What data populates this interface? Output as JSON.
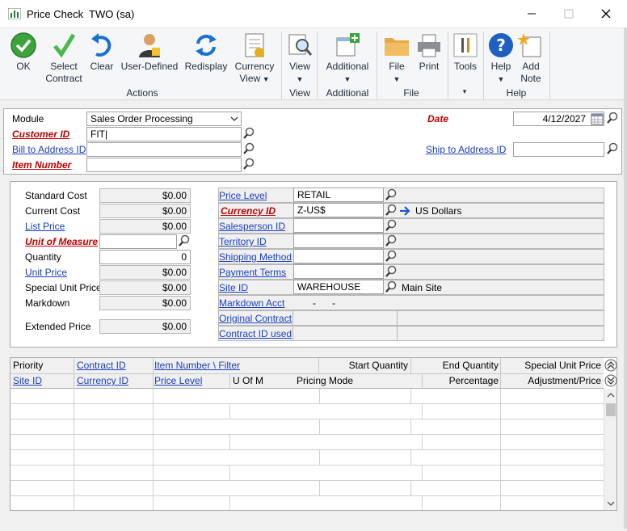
{
  "window": {
    "title": "Price Check",
    "company": "TWO (sa)"
  },
  "ribbon": {
    "buttons": {
      "ok": "OK",
      "select_contract": [
        "Select",
        "Contract"
      ],
      "clear": "Clear",
      "user_defined": "User-Defined",
      "redisplay": "Redisplay",
      "currency_view": [
        "Currency",
        "View"
      ],
      "view": "View",
      "additional": "Additional",
      "file": "File",
      "print": "Print",
      "tools": "Tools",
      "help": "Help",
      "add_note": [
        "Add",
        "Note"
      ]
    },
    "groups": {
      "actions": "Actions",
      "view": "View",
      "additional": "Additional",
      "file": "File",
      "help": "Help"
    }
  },
  "header": {
    "module_label": "Module",
    "module_value": "Sales Order Processing",
    "date_label": "Date",
    "date_value": "4/12/2027",
    "customer_id_label": "Customer ID",
    "customer_id_value": "FIT|",
    "bill_to_label": "Bill to Address ID",
    "ship_to_label": "Ship to Address ID",
    "item_number_label": "Item Number"
  },
  "left": {
    "standard_cost": {
      "label": "Standard Cost",
      "value": "$0.00"
    },
    "current_cost": {
      "label": "Current Cost",
      "value": "$0.00"
    },
    "list_price": {
      "label": "List Price",
      "value": "$0.00"
    },
    "uom": {
      "label": "Unit of Measure",
      "value": ""
    },
    "quantity": {
      "label": "Quantity",
      "value": "0"
    },
    "unit_price": {
      "label": "Unit Price",
      "value": "$0.00"
    },
    "special_unit_price": {
      "label": "Special Unit Price",
      "value": "$0.00"
    },
    "markdown": {
      "label": "Markdown",
      "value": "$0.00"
    },
    "extended_price": {
      "label": "Extended Price",
      "value": "$0.00"
    }
  },
  "right": {
    "price_level": {
      "label": "Price Level",
      "value": "RETAIL"
    },
    "currency_id": {
      "label": "Currency ID",
      "value": "Z-US$",
      "description": "US Dollars"
    },
    "salesperson_id": {
      "label": "Salesperson ID",
      "value": ""
    },
    "territory_id": {
      "label": "Territory ID",
      "value": ""
    },
    "shipping_method": {
      "label": "Shipping Method",
      "value": ""
    },
    "payment_terms": {
      "label": "Payment Terms",
      "value": ""
    },
    "site_id": {
      "label": "Site ID",
      "value": "WAREHOUSE",
      "description": "Main Site"
    },
    "markdown_acct": {
      "label": "Markdown Acct",
      "value": "-      -"
    },
    "original_contract": {
      "label": "Original Contract"
    },
    "contract_id_used": {
      "label": "Contract ID used"
    }
  },
  "grid": {
    "row1": [
      "Priority",
      "Contract ID",
      "Item Number \\ Filter",
      "Start Quantity",
      "End Quantity",
      "Special Unit Price"
    ],
    "row2": [
      "Site ID",
      "Currency ID",
      "Price Level",
      "U Of M",
      "Pricing Mode",
      "Percentage",
      "Adjustment/Price"
    ]
  }
}
